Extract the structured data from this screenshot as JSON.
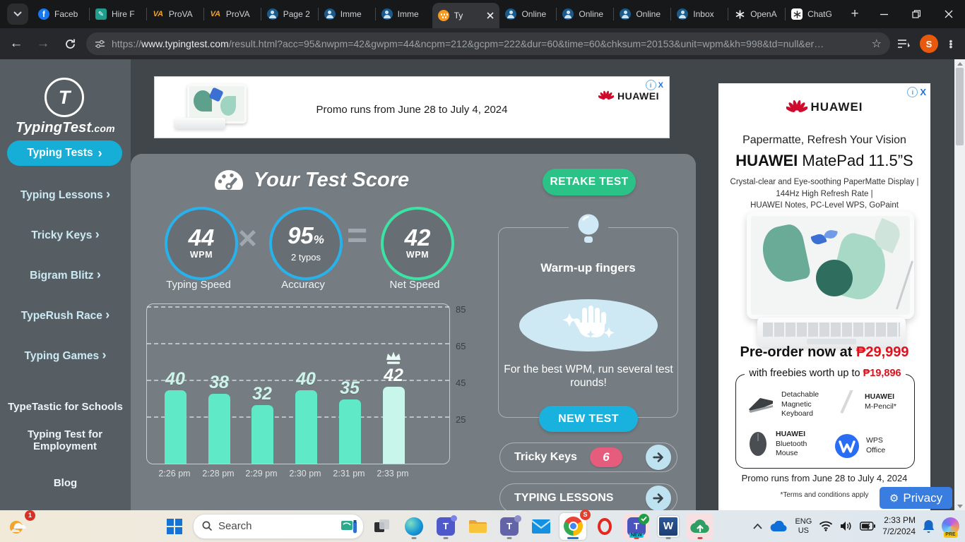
{
  "colors": {
    "accent_teal": "#16aed6",
    "button_green": "#2bc287",
    "button_cyan": "#19b2de",
    "circle_blue_border": "#28b2ec",
    "circle_green_border": "#3ce3a4",
    "badge_pink": "#e55c7c",
    "huawei_red": "#cf0a2c",
    "price_red": "#e0101c",
    "privacy_blue": "#3a7de0",
    "card_gray": "#757d83",
    "sidebar_gray": "#565e63"
  },
  "icons": {
    "chevron_right": "›",
    "multiply": "×",
    "equals": "=",
    "gear": "⚙",
    "star": "☆",
    "info": "i",
    "close_x": "X",
    "plus": "+",
    "back": "←",
    "forward": "→"
  },
  "browser": {
    "tabs": [
      "Faceb",
      "Hire F",
      "ProVA",
      "ProVA",
      "Page 2",
      "Imme",
      "Imme",
      "Ty",
      "Online",
      "Online",
      "Online",
      "Inbox",
      "OpenA",
      "ChatG"
    ],
    "url": {
      "scheme": "https://",
      "host": "www.typingtest.com",
      "path": "/result.html?acc=95&nwpm=42&gwpm=44&ncpm=212&gcpm=222&dur=60&time=60&chksum=20153&unit=wpm&kh=998&td=null&er…"
    },
    "avatar": "S"
  },
  "sidebar": {
    "logo_main": "TypingTest",
    "logo_suffix": ".com",
    "logo_letter": "T",
    "items": [
      {
        "label": "Typing Tests"
      },
      {
        "label": "Typing Lessons"
      },
      {
        "label": "Tricky Keys"
      },
      {
        "label": "Bigram Blitz"
      },
      {
        "label": "TypeRush Race"
      },
      {
        "label": "Typing Games"
      },
      {
        "label": "TypeTastic for Schools"
      },
      {
        "label": "Typing Test for Employment"
      },
      {
        "label": "Blog"
      }
    ]
  },
  "banner_ad": {
    "promo": "Promo runs from June 28 to July 4, 2024",
    "brand": "HUAWEI"
  },
  "score": {
    "title": "Your Test Score",
    "retake_label": "RETAKE TEST",
    "typing_speed": {
      "value": "44",
      "unit": "WPM",
      "label": "Typing Speed"
    },
    "accuracy": {
      "value": "95",
      "unit": "%",
      "detail": "2 typos",
      "label": "Accuracy"
    },
    "net_speed": {
      "value": "42",
      "unit": "WPM",
      "label": "Net Speed"
    }
  },
  "chart_data": {
    "type": "bar",
    "x": [
      "2:26 pm",
      "2:28 pm",
      "2:29 pm",
      "2:30 pm",
      "2:31 pm",
      "2:33 pm"
    ],
    "values": [
      40,
      38,
      32,
      40,
      35,
      42
    ],
    "best_index": 5,
    "yticks": [
      25,
      45,
      65,
      85
    ],
    "ylim": [
      0,
      87
    ],
    "grid": "horizontal-dashed",
    "bar_color": "#5fe9c6",
    "best_bar_color": "#c9f6ea"
  },
  "warmup": {
    "title": "Warm-up fingers",
    "tip": "For the best WPM, run several test rounds!",
    "new_test_label": "NEW TEST"
  },
  "shortcuts": {
    "tricky_keys_label": "Tricky Keys",
    "tricky_keys_badge": "6",
    "typing_lessons_label": "TYPING LESSONS"
  },
  "side_ad": {
    "brand": "HUAWEI",
    "tagline": "Papermatte, Refresh Your Vision",
    "product_bold": "HUAWEI",
    "product_rest": " MatePad 11.5”S",
    "features": [
      "Crystal-clear and Eye-soothing PaperMatte Display  |",
      "144Hz High Refresh Rate  |",
      "HUAWEI Notes, PC-Level WPS, GoPaint"
    ],
    "preorder_prefix": "Pre-order now at ",
    "price": "₱29,999",
    "freebies_prefix": "with freebies worth up to ",
    "freebies_value": "₱19,896",
    "freebie_items": [
      {
        "l1": "Detachable",
        "l2": "Magnetic",
        "l3": "Keyboard"
      },
      {
        "l1": "HUAWEI",
        "l2": "M-Pencil*",
        "l3": ""
      },
      {
        "l1": "HUAWEI",
        "l2": "Bluetooth",
        "l3": "Mouse"
      },
      {
        "l1": "WPS",
        "l2": "Office",
        "l3": ""
      }
    ],
    "promo": "Promo runs from June 28 to July 4, 2024",
    "terms": "*Terms and conditions apply"
  },
  "privacy_label": "Privacy",
  "taskbar": {
    "search_label": "Search",
    "notification_count": "1",
    "teams_new_label": "NEW",
    "tray": {
      "lang1": "ENG",
      "lang2": "US",
      "time": "2:33 PM",
      "date": "7/2/2024",
      "copilot_badge": "PRE"
    }
  }
}
